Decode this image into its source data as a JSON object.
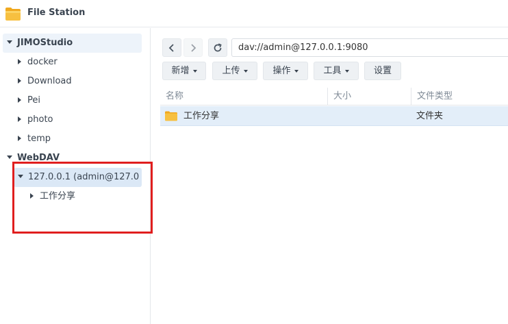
{
  "app": {
    "title": "File Station",
    "icon": "folder-icon",
    "accent_color": "#f5a623"
  },
  "sidebar": {
    "groups": [
      {
        "label": "JIMOStudio",
        "expanded": true,
        "items": [
          "docker",
          "Download",
          "Pei",
          "photo",
          "temp"
        ]
      },
      {
        "label": "WebDAV",
        "expanded": true,
        "items": [
          {
            "label": "127.0.0.1 (admin@127.0",
            "selected": true,
            "children": [
              "工作分享"
            ]
          }
        ]
      }
    ],
    "highlight_color": "#e01e1e"
  },
  "toolbar": {
    "back_icon": "chevron-left-icon",
    "forward_icon": "chevron-right-icon",
    "refresh_icon": "refresh-icon",
    "address": "dav://admin@127.0.0.1:9080",
    "buttons": [
      "新增",
      "上传",
      "操作",
      "工具",
      "设置"
    ]
  },
  "file_list": {
    "columns": [
      "名称",
      "大小",
      "文件类型"
    ],
    "rows": [
      {
        "name": "工作分享",
        "size": "",
        "type": "文件夹",
        "selected": true
      }
    ]
  }
}
